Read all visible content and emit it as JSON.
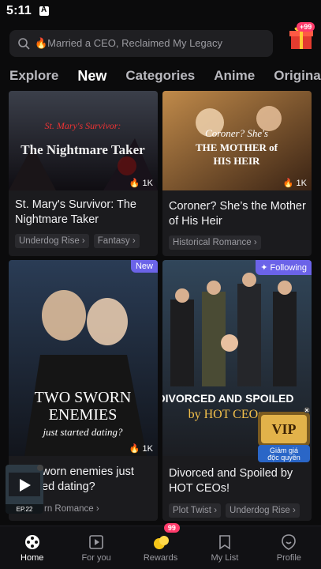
{
  "status_bar": {
    "time": "5:11"
  },
  "search": {
    "placeholder": "🔥Married a CEO, Reclaimed My Legacy"
  },
  "gift": {
    "badge": "+99"
  },
  "tabs": [
    {
      "label": "Explore"
    },
    {
      "label": "New"
    },
    {
      "label": "Categories"
    },
    {
      "label": "Anime"
    },
    {
      "label": "Origina"
    }
  ],
  "cards": [
    {
      "poster_title_line1": "St. Mary's Survivor:",
      "poster_title_line2": "The Nightmare Taker",
      "views": "1K",
      "title": "St. Mary's Survivor: The Nightmare Taker",
      "tags": [
        "Underdog Rise",
        "Fantasy"
      ]
    },
    {
      "poster_title_line1": "Coroner? She's",
      "poster_title_line2": "THE MOTHER of",
      "poster_title_line3": "HIS HEIR",
      "views": "1K",
      "title": "Coroner? She’s the Mother of His Heir",
      "tags": [
        "Historical Romance"
      ]
    },
    {
      "badge": "New",
      "poster_title_line1": "TWO SWORN",
      "poster_title_line2": "ENEMIES",
      "poster_title_line3": "just started dating?",
      "views": "1K",
      "title_visible": "wor enemies just ed dating?",
      "title_line1": "worn enemies just",
      "title_line2": "ed dating?",
      "tags": [
        "rn Romance"
      ]
    },
    {
      "badge": "Following",
      "poster_title_line1": "DIVORCED AND SPOILED",
      "poster_title_line2": "by HOT CEOs",
      "title": "Divorced and Spoiled by HOT CEOs!",
      "tags": [
        "Plot Twist",
        "Underdog Rise"
      ]
    }
  ],
  "vip_promo": {
    "label": "VIP",
    "caption_line1": "Giảm giá",
    "caption_line2": "độc quyền"
  },
  "mini_player": {
    "episode": "EP.22"
  },
  "bottom_nav": [
    {
      "label": "Home",
      "icon": "home-film-reel-icon"
    },
    {
      "label": "For you",
      "icon": "play-square-icon"
    },
    {
      "label": "Rewards",
      "icon": "coins-icon",
      "badge": "99"
    },
    {
      "label": "My List",
      "icon": "bookmark-icon"
    },
    {
      "label": "Profile",
      "icon": "smile-badge-icon"
    }
  ],
  "colors": {
    "accent": "#6b63e8",
    "badge_red": "#ff3b6b",
    "background": "#0b0b0c"
  }
}
